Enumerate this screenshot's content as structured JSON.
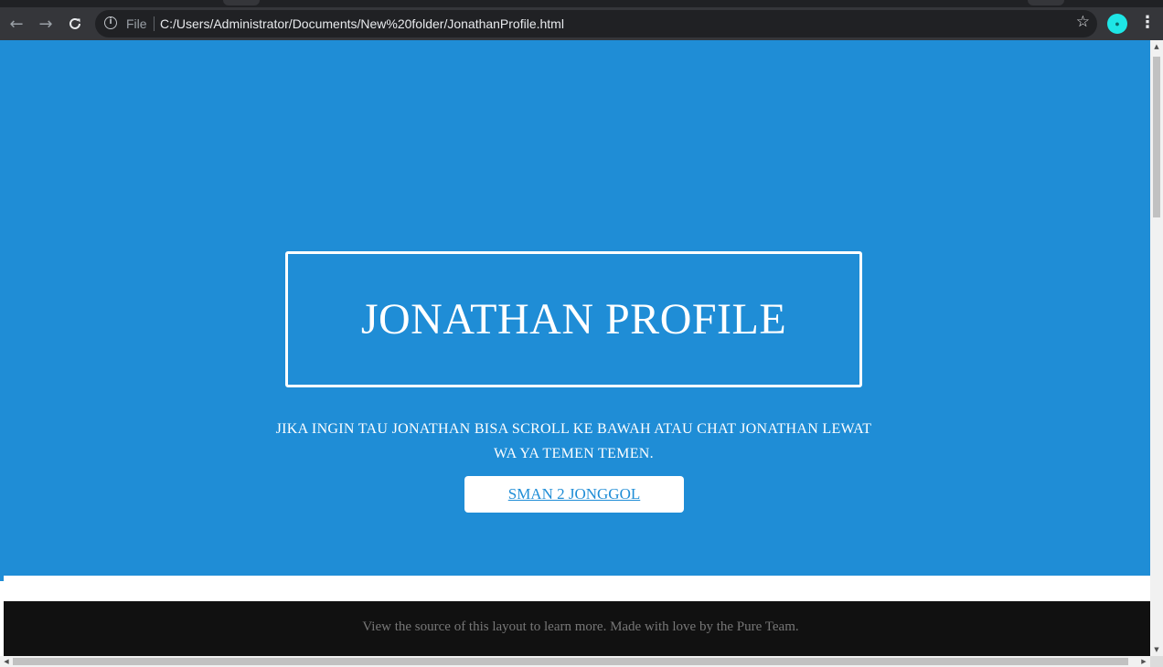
{
  "browser": {
    "scheme_label": "File",
    "url": "C:/Users/Administrator/Documents/New%20folder/JonathanProfile.html",
    "icons": {
      "back": "arrow-left",
      "forward": "arrow-right",
      "reload": "reload",
      "info": "info",
      "bookmark": "star",
      "extension": "profile-avatar",
      "menu": "kebab-menu"
    }
  },
  "hero": {
    "title": "JONATHAN PROFILE",
    "subtitle": "JIKA INGIN TAU JONATHAN BISA SCROLL KE BAWAH ATAU CHAT JONATHAN LEWAT WA YA TEMEN TEMEN.",
    "button_label": "SMAN 2 JONGGOL",
    "background_color": "#1f8dd6"
  },
  "footer": {
    "text": "View the source of this layout to learn more. Made with love by the Pure Team."
  }
}
